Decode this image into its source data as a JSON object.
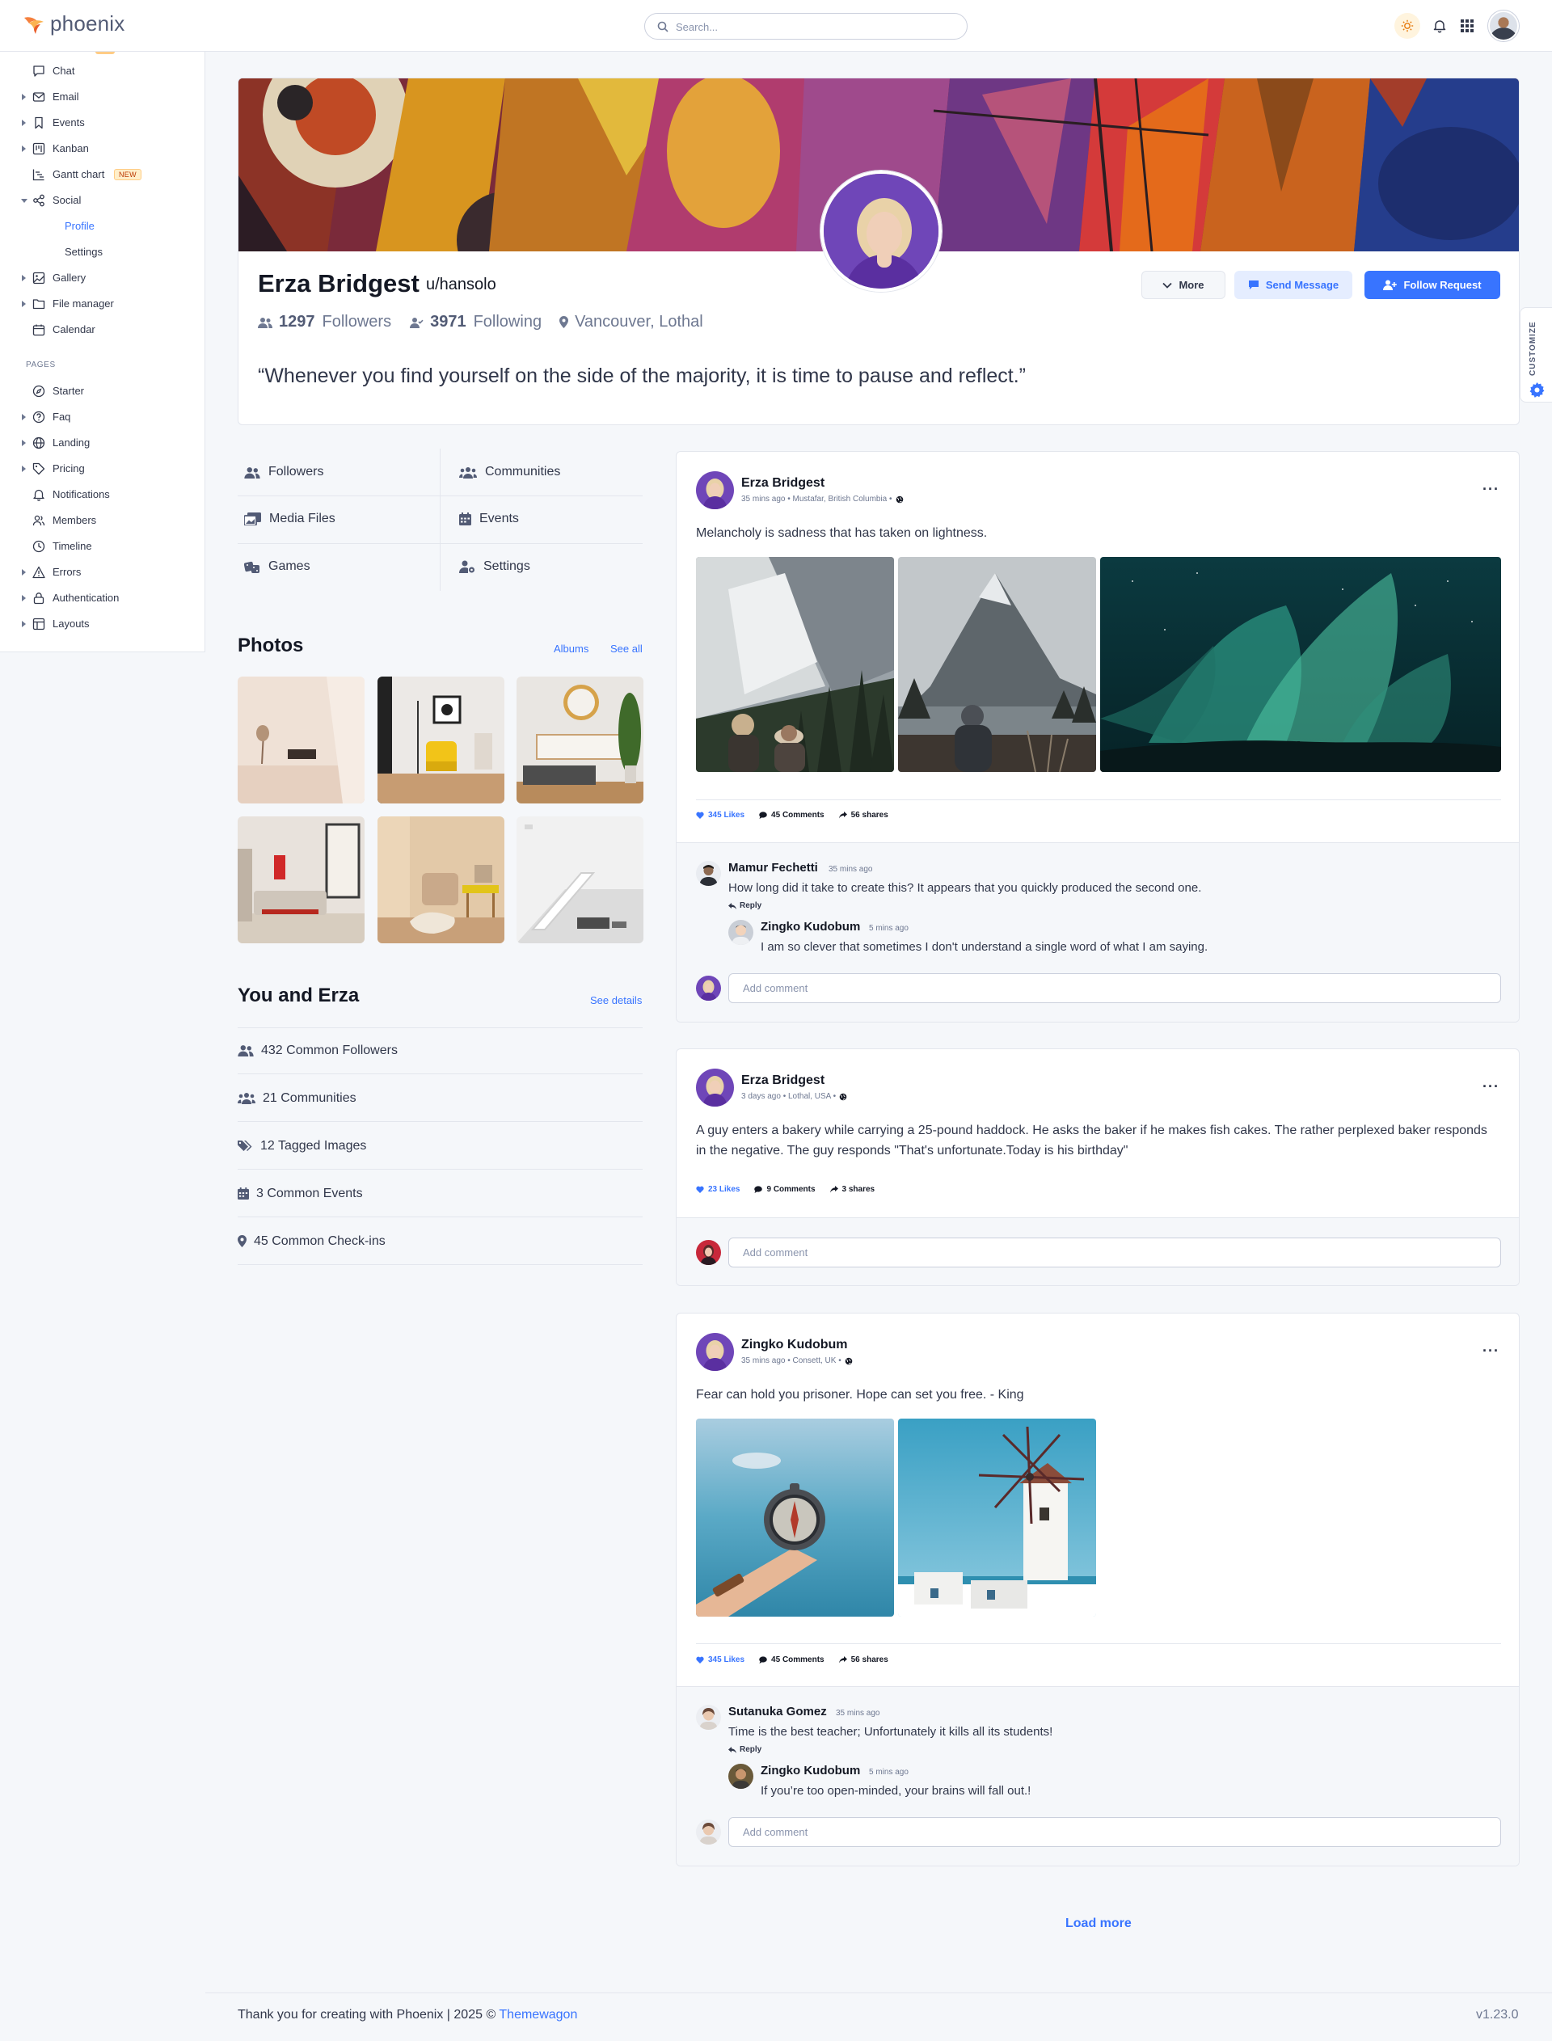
{
  "brand": {
    "name": "phoenix",
    "accent": "#3874ff"
  },
  "search": {
    "placeholder": "Search..."
  },
  "sidebar": {
    "items": [
      {
        "label": "Chat",
        "icon": "chat-icon"
      },
      {
        "label": "Email",
        "icon": "email-icon"
      },
      {
        "label": "Events",
        "icon": "bookmark-icon"
      },
      {
        "label": "Kanban",
        "icon": "kanban-icon"
      },
      {
        "label": "Gantt chart",
        "icon": "gantt-icon",
        "badge": "NEW"
      },
      {
        "label": "Social",
        "icon": "share-icon"
      },
      {
        "label": "Profile"
      },
      {
        "label": "Settings"
      },
      {
        "label": "Gallery",
        "icon": "image-icon"
      },
      {
        "label": "File manager",
        "icon": "folder-icon"
      },
      {
        "label": "Calendar",
        "icon": "calendar-icon"
      }
    ],
    "pages_caption": "PAGES",
    "pages": [
      {
        "label": "Starter",
        "icon": "compass-icon"
      },
      {
        "label": "Faq",
        "icon": "help-icon"
      },
      {
        "label": "Landing",
        "icon": "globe-icon"
      },
      {
        "label": "Pricing",
        "icon": "tag-icon"
      },
      {
        "label": "Notifications",
        "icon": "bell-icon"
      },
      {
        "label": "Members",
        "icon": "users-icon"
      },
      {
        "label": "Timeline",
        "icon": "clock-icon"
      },
      {
        "label": "Errors",
        "icon": "alert-icon"
      },
      {
        "label": "Authentication",
        "icon": "lock-icon"
      },
      {
        "label": "Layouts",
        "icon": "layout-icon"
      }
    ]
  },
  "profile": {
    "name": "Erza Bridgest",
    "username": "u/hansolo",
    "followers_count": "1297",
    "followers_label": "Followers",
    "following_count": "3971",
    "following_label": "Following",
    "location": "Vancouver, Lothal",
    "quote": "“Whenever you find yourself on the side of the majority, it is time to pause and reflect.”",
    "buttons": {
      "more": "More",
      "message": "Send Message",
      "follow": "Follow Request"
    }
  },
  "customize_label": "CUSTOMIZE",
  "profile_nav": [
    {
      "label": "Followers",
      "icon": "users-icon"
    },
    {
      "label": "Communities",
      "icon": "group-icon"
    },
    {
      "label": "Media Files",
      "icon": "photos-icon"
    },
    {
      "label": "Events",
      "icon": "calendar-icon"
    },
    {
      "label": "Games",
      "icon": "dice-icon"
    },
    {
      "label": "Settings",
      "icon": "user-gear-icon"
    }
  ],
  "photos": {
    "title": "Photos",
    "albums_link": "Albums",
    "see_all_link": "See all"
  },
  "you_and": {
    "title": "You and Erza",
    "link": "See details",
    "rows": [
      {
        "label": "432 Common Followers",
        "icon": "users-icon"
      },
      {
        "label": "21 Communities",
        "icon": "group-icon"
      },
      {
        "label": "12 Tagged Images",
        "icon": "tags-icon"
      },
      {
        "label": "3 Common Events",
        "icon": "calendar-icon"
      },
      {
        "label": "45 Common Check-ins",
        "icon": "pin-icon"
      }
    ]
  },
  "posts": [
    {
      "author": "Erza Bridgest",
      "meta": "35 mins ago • Mustafar, British Columbia •",
      "text": "Melancholy is sadness that has taken on lightness.",
      "likes": "345 Likes",
      "comments": "45 Comments",
      "shares": "56 shares",
      "comment_1": {
        "name": "Mamur Fechetti",
        "time": "35 mins ago",
        "text": "How long did it take to create this? It appears that you quickly produced the second one.",
        "reply": "Reply"
      },
      "comment_2": {
        "name": "Zingko Kudobum",
        "time": "5 mins ago",
        "text": "I am so clever that sometimes I don't understand a single word of what I am saying."
      },
      "add_comment": "Add comment"
    },
    {
      "author": "Erza Bridgest",
      "meta": "3 days ago • Lothal, USA •",
      "text": "A guy enters a bakery while carrying a 25-pound haddock. He asks the baker if he makes fish cakes. The rather perplexed baker responds in the negative. The guy responds \"That's unfortunate.Today is his birthday\"",
      "likes": "23 Likes",
      "comments": "9 Comments",
      "shares": "3 shares",
      "add_comment": "Add comment"
    },
    {
      "author": "Zingko Kudobum",
      "meta": "35 mins ago • Consett, UK •",
      "text": "Fear can hold you prisoner. Hope can set you free. - King",
      "likes": "345 Likes",
      "comments": "45 Comments",
      "shares": "56 shares",
      "comment_1": {
        "name": "Sutanuka Gomez",
        "time": "35 mins ago",
        "text": "Time is the best teacher; Unfortunately it kills all its students!",
        "reply": "Reply"
      },
      "comment_2": {
        "name": "Zingko Kudobum",
        "time": "5 mins ago",
        "text": "If you’re too open-minded, your brains will fall out.!"
      },
      "add_comment": "Add comment"
    }
  ],
  "load_more": "Load more",
  "footer": {
    "text": "Thank you for creating with Phoenix | 2025 © ",
    "link": "Themewagon",
    "version": "v1.23.0"
  }
}
